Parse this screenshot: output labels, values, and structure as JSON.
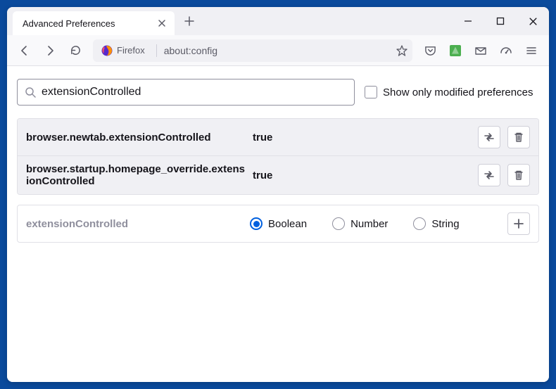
{
  "window": {
    "tab_title": "Advanced Preferences"
  },
  "urlbar": {
    "identity": "Firefox",
    "url": "about:config"
  },
  "search": {
    "value": "extensionControlled",
    "show_modified_label": "Show only modified preferences"
  },
  "prefs": [
    {
      "name": "browser.newtab.extensionControlled",
      "value": "true"
    },
    {
      "name": "browser.startup.homepage_override.extensionControlled",
      "value": "true"
    }
  ],
  "new_pref": {
    "name": "extensionControlled",
    "types": [
      "Boolean",
      "Number",
      "String"
    ],
    "selected": "Boolean"
  }
}
